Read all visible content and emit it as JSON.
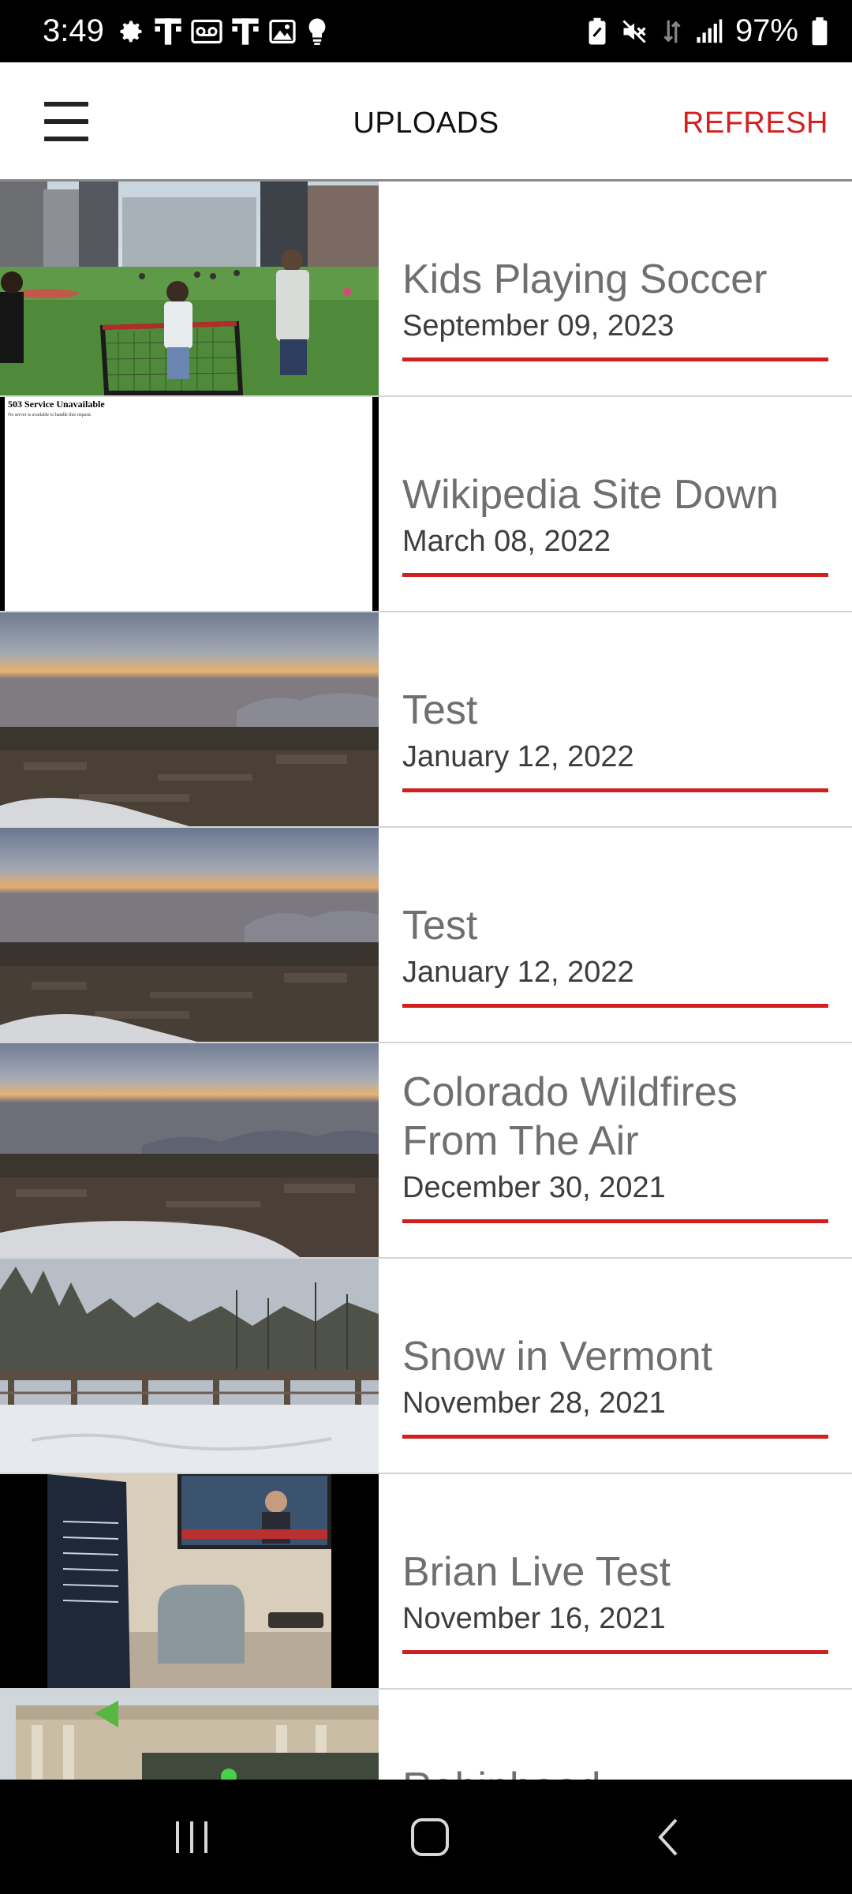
{
  "status_bar": {
    "time": "3:49",
    "battery": "97%",
    "left_icons": [
      "settings-icon",
      "tmobile-icon",
      "voicemail-icon",
      "tmobile-icon",
      "gallery-icon",
      "bulb-icon"
    ],
    "right_icons": [
      "battery-saver-icon",
      "mute-icon",
      "data-icon",
      "signal-icon",
      "battery-icon"
    ]
  },
  "app_bar": {
    "title": "UPLOADS",
    "refresh_label": "REFRESH",
    "menu_icon": "hamburger-menu-icon"
  },
  "uploads": [
    {
      "title": "Kids Playing Soccer",
      "date": "September 09, 2023",
      "thumbnail": "soccer"
    },
    {
      "title": "Wikipedia Site Down",
      "date": "March 08, 2022",
      "thumbnail": "error-page",
      "thumb_heading": "503 Service Unavailable",
      "thumb_text": "No server is available to handle this request."
    },
    {
      "title": "Test",
      "date": "January 12, 2022",
      "thumbnail": "aerial-dusk"
    },
    {
      "title": "Test",
      "date": "January 12, 2022",
      "thumbnail": "aerial-dusk"
    },
    {
      "title": "Colorado Wildfires From The Air",
      "date": "December 30, 2021",
      "thumbnail": "aerial-smoke"
    },
    {
      "title": "Snow in Vermont",
      "date": "November 28, 2021",
      "thumbnail": "snow"
    },
    {
      "title": "Brian Live Test",
      "date": "November 16, 2021",
      "thumbnail": "office"
    },
    {
      "title": "Robinhood",
      "date": "",
      "thumbnail": "building"
    }
  ],
  "nav_bar": {
    "icons": [
      "recents-icon",
      "home-icon",
      "back-icon"
    ]
  },
  "colors": {
    "accent": "#d51f1f",
    "title_text": "#6f6f6f",
    "date_text": "#3d3d3d",
    "divider": "#d4d4d4"
  }
}
